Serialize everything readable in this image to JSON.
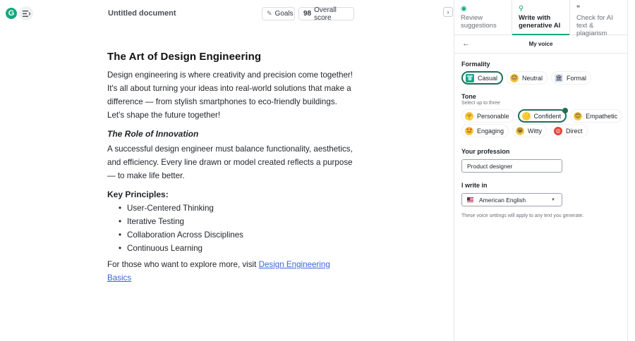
{
  "editor": {
    "document_title": "Untitled document",
    "goals_label": "Goals",
    "score_value": "98",
    "score_label": "Overall score"
  },
  "document": {
    "heading": "The Art of Design Engineering",
    "intro": "Design engineering is where creativity and precision come together! It's all about turning your ideas into real-world solutions that make a difference — from stylish smartphones to eco-friendly buildings. Let's shape the future together!",
    "subheading": "The Role of Innovation",
    "paragraph2": "A successful design engineer must balance functionality, aesthetics, and efficiency. Every line drawn or model created reflects a purpose — to make life better.",
    "principles_heading": "Key Principles:",
    "principles": [
      "User-Centered Thinking",
      "Iterative Testing",
      "Collaboration Across Disciplines",
      "Continuous Learning"
    ],
    "closing_text": "For those who want to explore more, visit ",
    "closing_link": "Design Engineering Basics"
  },
  "panel": {
    "tabs": [
      {
        "line1": "Review",
        "line2": "suggestions"
      },
      {
        "line1": "Write with",
        "line2": "generative AI"
      },
      {
        "line1": "Check for AI",
        "line2": "text & plagiarism"
      }
    ],
    "subheader": "My voice",
    "formality": {
      "title": "Formality",
      "options": [
        "Casual",
        "Neutral",
        "Formal"
      ],
      "selected": "Casual"
    },
    "tone": {
      "title": "Tone",
      "subtitle": "Select up to three",
      "row1": [
        "Personable",
        "Confident",
        "Empathetic"
      ],
      "row2": [
        "Engaging",
        "Witty",
        "Direct"
      ],
      "selected": "Confident"
    },
    "profession": {
      "title": "Your profession",
      "value": "Product designer"
    },
    "language": {
      "title": "I write in",
      "value": "American English"
    },
    "note": "These voice settings will apply to any text you generate."
  },
  "colors": {
    "brand": "#15a87f",
    "selected_border": "#1f6f58",
    "link": "#3a66d6"
  }
}
